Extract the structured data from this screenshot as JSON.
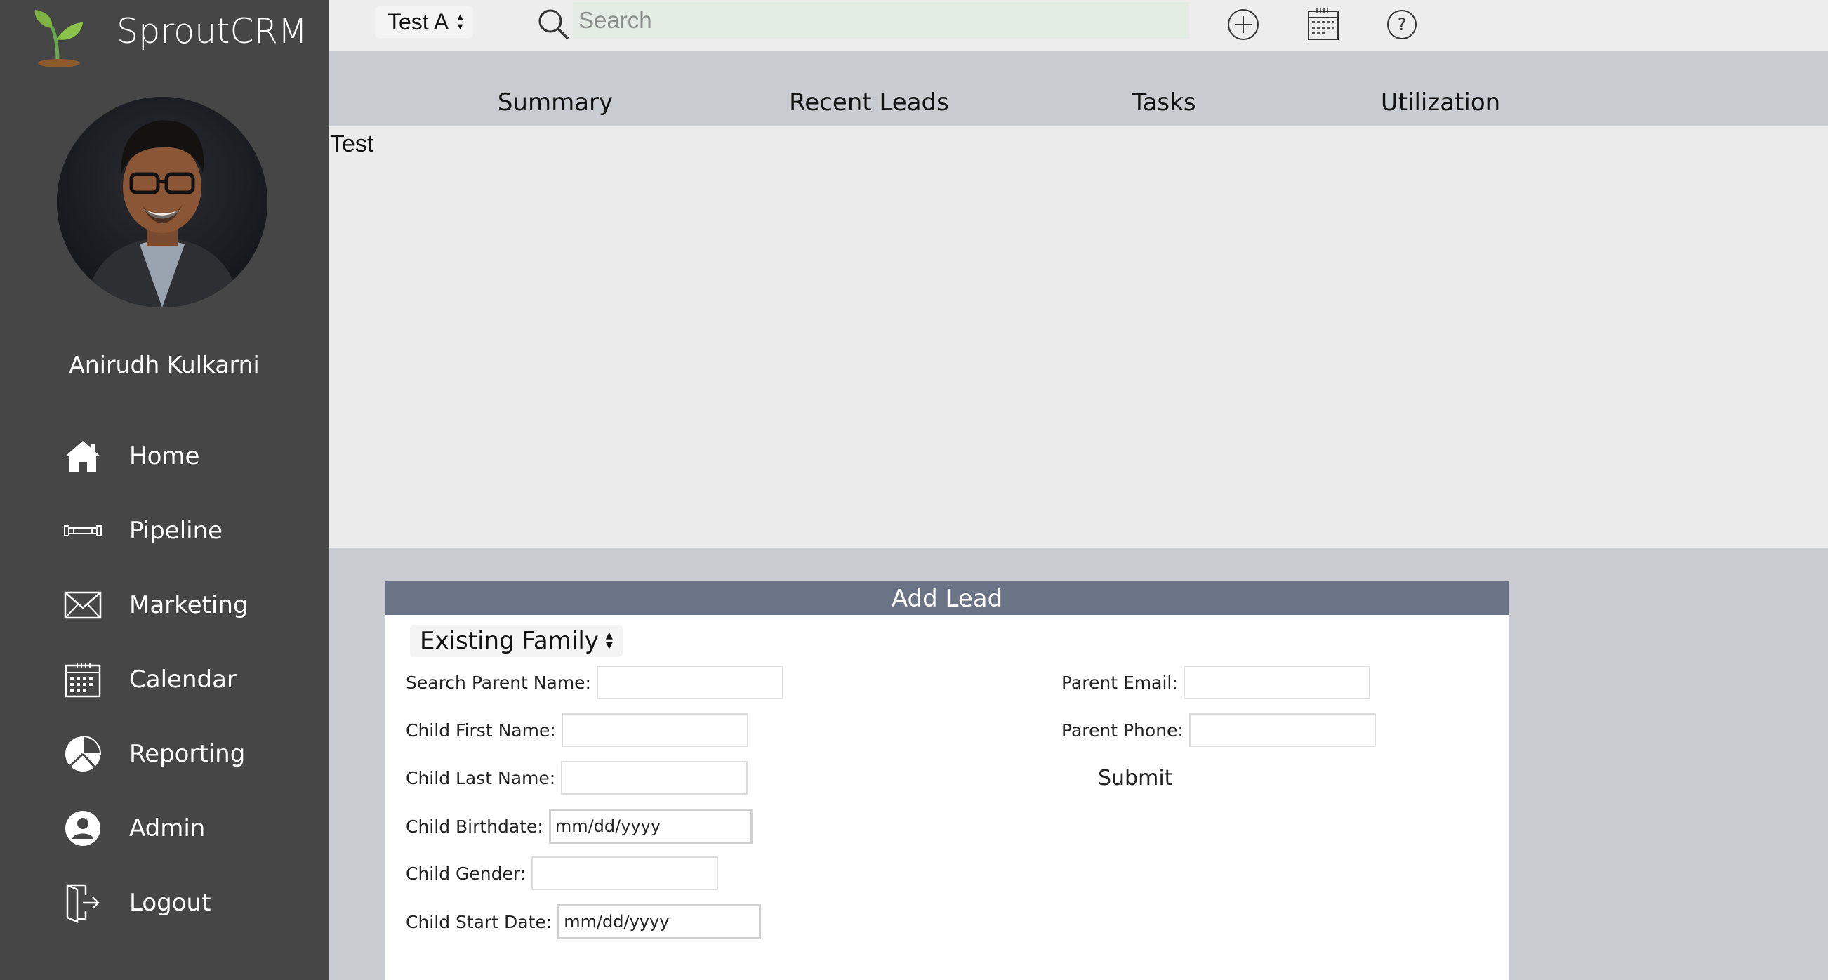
{
  "brand": {
    "name": "SproutCRM",
    "logo_icon": "sprout-logo-icon"
  },
  "user": {
    "name": "Anirudh Kulkarni",
    "avatar": "profile-photo"
  },
  "sidebar": {
    "items": [
      {
        "label": "Home",
        "icon": "home-icon"
      },
      {
        "label": "Pipeline",
        "icon": "pipeline-icon"
      },
      {
        "label": "Marketing",
        "icon": "envelope-icon"
      },
      {
        "label": "Calendar",
        "icon": "calendar-icon"
      },
      {
        "label": "Reporting",
        "icon": "pie-chart-icon"
      },
      {
        "label": "Admin",
        "icon": "user-circle-icon"
      },
      {
        "label": "Logout",
        "icon": "logout-door-icon"
      }
    ]
  },
  "topbar": {
    "selected_center": "Test A",
    "search_placeholder": "Search",
    "icons": [
      "add-circle-icon",
      "calendar-icon",
      "help-circle-icon"
    ]
  },
  "tabs": [
    "Summary",
    "Recent Leads",
    "Tasks",
    "Utilization"
  ],
  "content": {
    "text": "Test"
  },
  "add_lead": {
    "title": "Add Lead",
    "family_type": "Existing Family",
    "fields": {
      "search_parent_name": {
        "label": "Search Parent Name:",
        "value": ""
      },
      "child_first_name": {
        "label": "Child First Name:",
        "value": ""
      },
      "child_last_name": {
        "label": "Child Last Name:",
        "value": ""
      },
      "child_birthdate": {
        "label": "Child Birthdate:",
        "value": "mm/dd/yyyy"
      },
      "child_gender": {
        "label": "Child Gender:",
        "value": ""
      },
      "child_start_date": {
        "label": "Child Start Date:",
        "value": "mm/dd/yyyy"
      },
      "parent_email": {
        "label": "Parent Email:",
        "value": ""
      },
      "parent_phone": {
        "label": "Parent Phone:",
        "value": ""
      }
    },
    "submit_label": "Submit"
  },
  "colors": {
    "sidebar_bg": "#464646",
    "topbar_bg": "#ededed",
    "tabs_bg": "#c9cdd1",
    "panel_header": "#6b7386",
    "search_bg": "#e4ede4"
  }
}
